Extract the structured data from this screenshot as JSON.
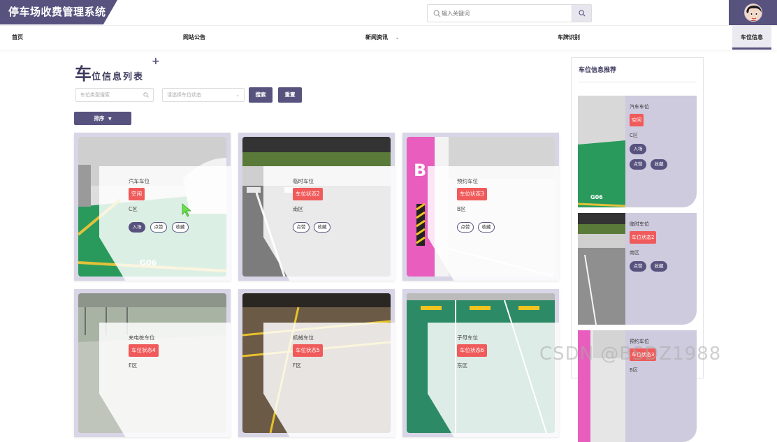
{
  "app": {
    "title": "停车场收费管理系统"
  },
  "search": {
    "placeholder": "输入关键词"
  },
  "nav": {
    "items": [
      {
        "label": "首页"
      },
      {
        "label": "网站公告"
      },
      {
        "label": "新闻资讯"
      },
      {
        "label": "车牌识别"
      },
      {
        "label": "车位信息"
      }
    ],
    "active": "车位信息"
  },
  "page": {
    "title_big": "车",
    "title_rest": "位信息列表",
    "title_plus": "+"
  },
  "filters": {
    "type_placeholder": "车位类型搜索",
    "status_placeholder": "请选择车位状态",
    "search_label": "搜索",
    "reset_label": "重置",
    "sort_label": "排序"
  },
  "cards": [
    {
      "name": "汽车车位",
      "status": "空闲",
      "zone": "C区",
      "actions": [
        "入场",
        "点赞",
        "收藏"
      ]
    },
    {
      "name": "临时车位",
      "status": "车位状态2",
      "zone": "南区",
      "actions": [
        "点赞",
        "收藏"
      ]
    },
    {
      "name": "预约车位",
      "status": "车位状态3",
      "zone": "B区",
      "actions": [
        "点赞",
        "收藏"
      ]
    },
    {
      "name": "充电桩车位",
      "status": "车位状态4",
      "zone": "E区"
    },
    {
      "name": "机械车位",
      "status": "车位状态5",
      "zone": "F区"
    },
    {
      "name": "子母车位",
      "status": "车位状态6",
      "zone": "东区"
    }
  ],
  "sidebar": {
    "title": "车位信息推荐",
    "items": [
      {
        "name": "汽车车位",
        "status": "空闲",
        "zone": "C区",
        "enter": "入场",
        "like": "点赞",
        "fav": "收藏"
      },
      {
        "name": "临时车位",
        "status": "车位状态2",
        "zone": "南区",
        "like": "点赞",
        "fav": "收藏"
      },
      {
        "name": "预约车位",
        "status": "车位状态3",
        "zone": "B区"
      }
    ]
  },
  "photo_text": {
    "g06": "G06",
    "b_letter": "B"
  },
  "watermark": "CSDN @BSDZ1988",
  "colors": {
    "primary": "#57527e",
    "badge": "#f05a5a",
    "card_bg": "#d8d5e6"
  }
}
